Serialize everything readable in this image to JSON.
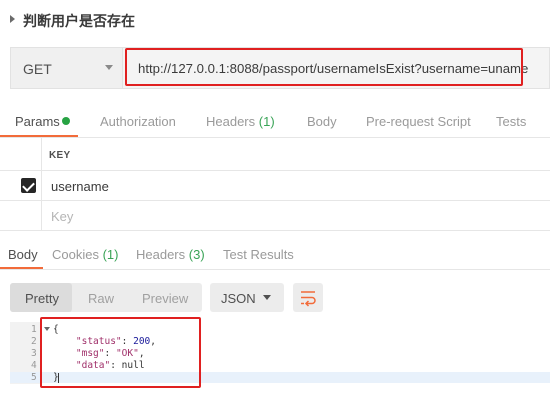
{
  "request": {
    "title": "判断用户是否存在",
    "method": "GET",
    "url": "http://127.0.0.1:8088/passport/usernameIsExist?username=uname"
  },
  "request_tabs": {
    "params": "Params",
    "authorization": "Authorization",
    "headers": "Headers",
    "headers_count": "(1)",
    "body": "Body",
    "pre_request_script": "Pre-request Script",
    "tests": "Tests"
  },
  "params_table": {
    "key_header": "KEY",
    "rows": [
      {
        "key": "username",
        "checked": true
      }
    ],
    "key_placeholder": "Key"
  },
  "response_tabs": {
    "body": "Body",
    "cookies": "Cookies",
    "cookies_count": "(1)",
    "headers": "Headers",
    "headers_count": "(3)",
    "test_results": "Test Results"
  },
  "response_toolbar": {
    "pretty": "Pretty",
    "raw": "Raw",
    "preview": "Preview",
    "language": "JSON",
    "wrap_icon": "wrap-lines-icon"
  },
  "response_body": {
    "line_numbers": [
      "1",
      "2",
      "3",
      "4",
      "5"
    ],
    "open_brace": "{",
    "status_key": "\"status\"",
    "status_value": "200",
    "msg_key": "\"msg\"",
    "msg_value": "\"OK\"",
    "data_key": "\"data\"",
    "data_value": "null",
    "close_brace": "}"
  },
  "colors": {
    "accent": "#f26b3a",
    "highlight_box": "#e02020",
    "status_dot": "#27a343"
  }
}
